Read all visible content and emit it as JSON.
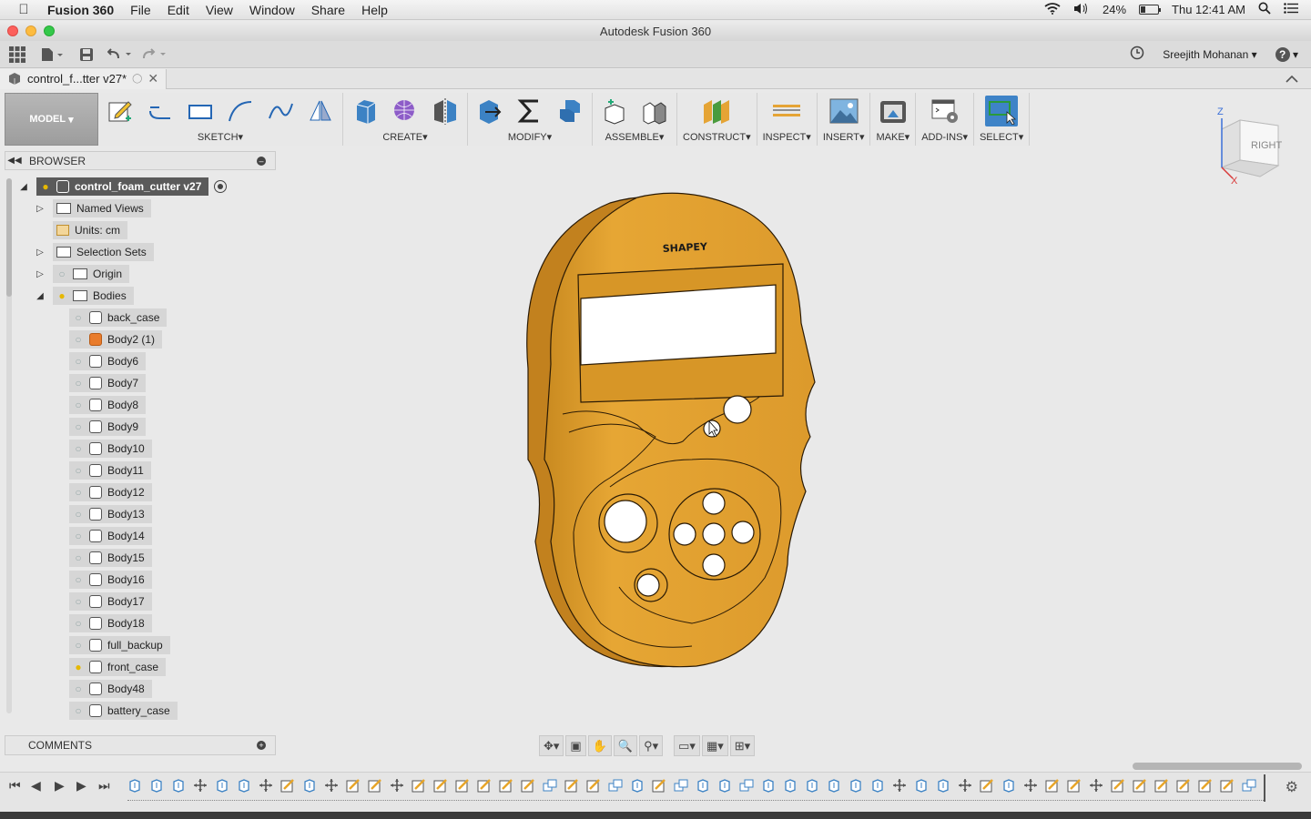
{
  "menubar": {
    "app_name": "Fusion 360",
    "menus": [
      "File",
      "Edit",
      "View",
      "Window",
      "Share",
      "Help"
    ],
    "battery": "24%",
    "clock": "Thu 12:41 AM"
  },
  "window": {
    "title": "Autodesk Fusion 360"
  },
  "quickbar": {
    "user": "Sreejith Mohanan"
  },
  "doc_tab": {
    "label": "control_f...tter v27*"
  },
  "toolbar": {
    "workspace": "MODEL",
    "groups": [
      "SKETCH",
      "CREATE",
      "MODIFY",
      "ASSEMBLE",
      "CONSTRUCT",
      "INSPECT",
      "INSERT",
      "MAKE",
      "ADD-INS",
      "SELECT"
    ]
  },
  "viewcube": {
    "face": "RIGHT",
    "axis_z": "Z",
    "axis_x": "X"
  },
  "browser": {
    "title": "BROWSER",
    "root": "control_foam_cutter v27",
    "named_views": "Named Views",
    "units": "Units: cm",
    "selection_sets": "Selection Sets",
    "origin": "Origin",
    "bodies_folder": "Bodies",
    "bodies": [
      "back_case",
      "Body2 (1)",
      "Body6",
      "Body7",
      "Body8",
      "Body9",
      "Body10",
      "Body11",
      "Body12",
      "Body13",
      "Body14",
      "Body15",
      "Body16",
      "Body17",
      "Body18",
      "full_backup",
      "front_case",
      "Body48",
      "battery_case"
    ]
  },
  "comments": {
    "title": "COMMENTS"
  },
  "model": {
    "engraving": "SHAPEY",
    "color": "#E5A435"
  }
}
